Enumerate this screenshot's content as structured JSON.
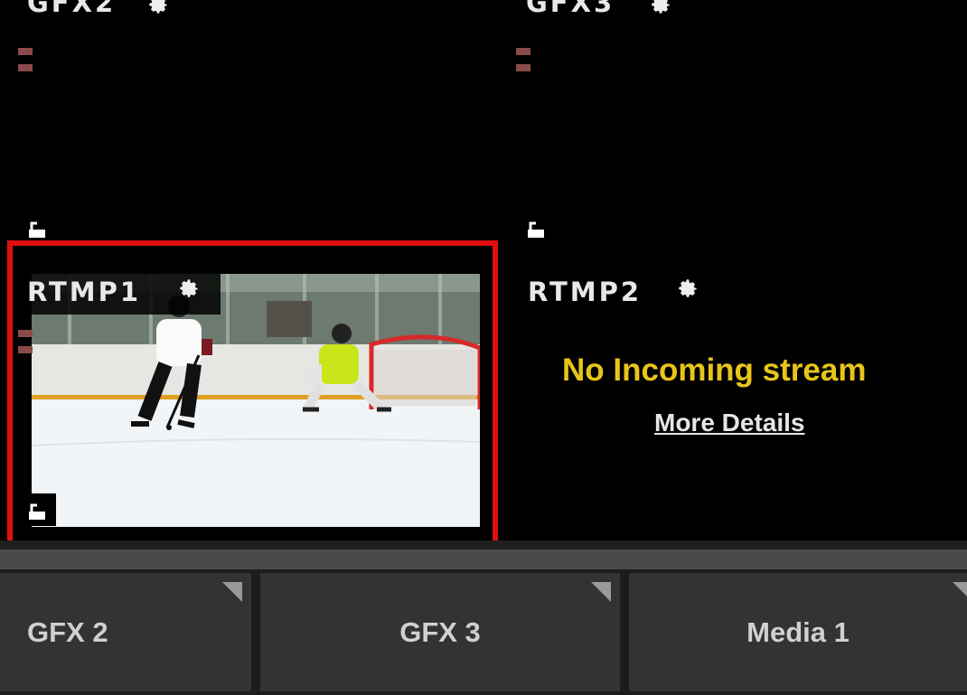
{
  "tiles": {
    "gfx2": {
      "label": "GFX2"
    },
    "gfx3": {
      "label": "GFX3"
    },
    "rtmp1": {
      "label": "RTMP1"
    },
    "rtmp2": {
      "label": "RTMP2",
      "status": "No Incoming stream",
      "details_link": "More Details"
    }
  },
  "bottom_bar": {
    "buttons": [
      {
        "label": "GFX 2"
      },
      {
        "label": "GFX 3"
      },
      {
        "label": "Media 1"
      }
    ]
  },
  "colors": {
    "highlight": "#e01010",
    "status_text": "#e8c51a",
    "meter": "#8b4a4a"
  },
  "icons": [
    "gear-icon",
    "lock-icon",
    "audio-meter",
    "dropdown-corner-icon"
  ]
}
